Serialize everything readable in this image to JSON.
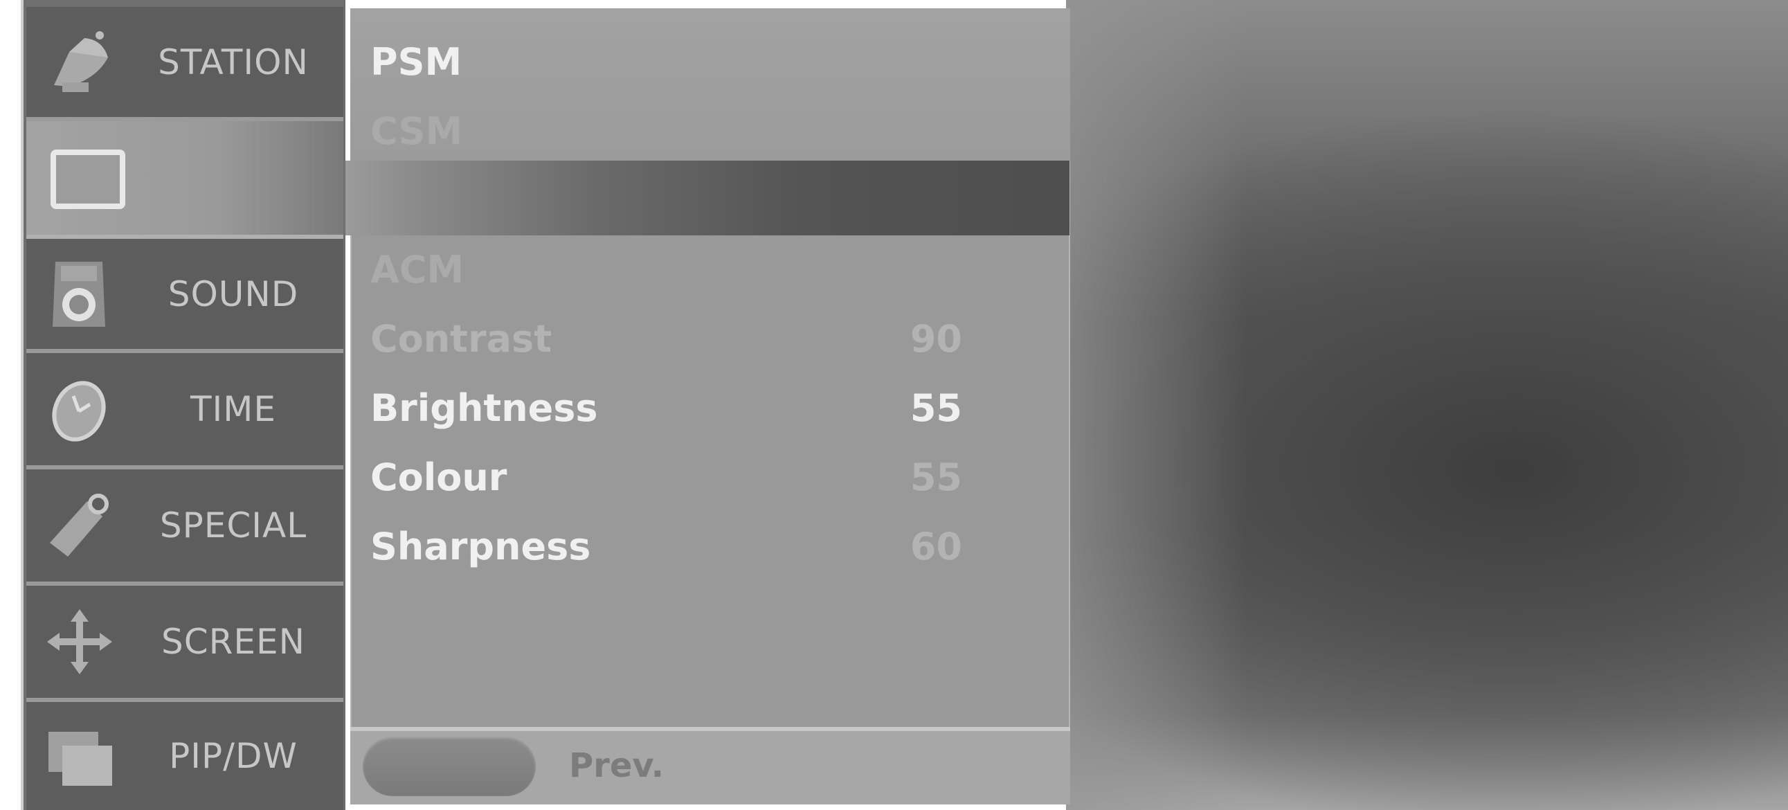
{
  "sidebar": {
    "items": [
      {
        "label": "STATION",
        "icon": "satellite-dish-icon"
      },
      {
        "label": "",
        "icon": "picture-screen-icon"
      },
      {
        "label": "SOUND",
        "icon": "speaker-icon"
      },
      {
        "label": "TIME",
        "icon": "clock-icon"
      },
      {
        "label": "SPECIAL",
        "icon": "tag-icon"
      },
      {
        "label": "SCREEN",
        "icon": "move-arrows-icon"
      },
      {
        "label": "PIP/DW",
        "icon": "pip-windows-icon"
      }
    ]
  },
  "menu": {
    "items": [
      {
        "label": "PSM",
        "value": ""
      },
      {
        "label": "CSM",
        "value": ""
      },
      {
        "label": "ACM",
        "value": ""
      },
      {
        "label": "Contrast",
        "value": "90"
      },
      {
        "label": "Brightness",
        "value": "55"
      },
      {
        "label": "Colour",
        "value": "55"
      },
      {
        "label": "Sharpness",
        "value": "60"
      }
    ]
  },
  "footer": {
    "prev_label": "Prev."
  },
  "colors": {
    "panel": "#999999",
    "sidebar": "#5d5d5d",
    "text_bright": "#f0f0f0",
    "text_dim": "#b3b3b3"
  }
}
